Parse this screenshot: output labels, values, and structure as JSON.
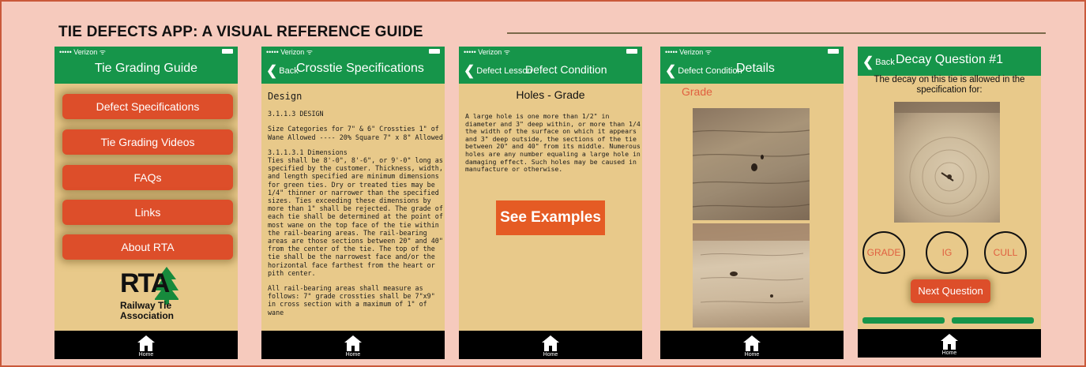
{
  "header": {
    "title": "TIE DEFECTS APP: A VISUAL REFERENCE GUIDE"
  },
  "colors": {
    "accent_green": "#16954a",
    "button_orange": "#dd4e2a",
    "screen_bg": "#e8c98a",
    "page_bg": "#f6cabd",
    "border": "#c9593a"
  },
  "status": {
    "carrier": "••••• Verizon ᯤ"
  },
  "tabbar": {
    "home_label": "Home",
    "icon": "home-icon"
  },
  "screen1": {
    "title": "Tie Grading Guide",
    "menu": [
      "Defect Specifications",
      "Tie Grading Videos",
      "FAQs",
      "Links",
      "About RTA"
    ],
    "logo": {
      "abbr": "RTA",
      "line1": "Railway Tie",
      "line2": "Association"
    }
  },
  "screen2": {
    "back": "Back",
    "title": "Crosstie Specifications",
    "heading": "Design",
    "paragraphs": [
      "3.1.1.3  DESIGN",
      "Size Categories for 7\" & 6\" Crossties   1\" of Wane Allowed ---- 20% Square 7\" x 8\" Allowed",
      "3.1.1.3.1  Dimensions\nTies shall be 8'-0\", 8'-6\", or 9'-0\" long as specified by the customer. Thickness, width, and length specified are minimum dimensions for green ties. Dry or treated ties may be 1/4\" thinner or narrower than the specified sizes. Ties exceeding these dimensions by more than 1\" shall be rejected. The grade of each tie shall be determined at the point of most wane on the top face of the tie within the rail-bearing areas. The rail-bearing areas are those sections between 20\" and 40\" from the center of the tie. The top of the tie shall be the narrowest face and/or the horizontal face farthest from the heart or pith center.",
      "All rail-bearing areas shall measure as follows: 7\" grade crossties shall be 7\"x9\" in cross section with a maximum of 1\" of wane"
    ]
  },
  "screen3": {
    "back": "Defect Lesson",
    "title": "Defect Condition",
    "heading": "Holes - Grade",
    "text": "A large hole is one more than 1/2\" in diameter and 3\" deep within, or more than 1/4 the width of the surface on which it appears and 3\" deep outside, the sections of the tie between 20\" and 40\" from its middle. Numerous holes are any number equaling a large hole in damaging effect. Such holes may be caused in manufacture or otherwise.",
    "button": "See Examples"
  },
  "screen4": {
    "back": "Defect Condition",
    "title": "Details",
    "label": "Grade"
  },
  "screen5": {
    "back": "Back",
    "title": "Decay Question #1",
    "question": "The decay on this tie is allowed in the specification for:",
    "options": [
      "GRADE",
      "IG",
      "CULL"
    ],
    "next": "Next Question"
  }
}
